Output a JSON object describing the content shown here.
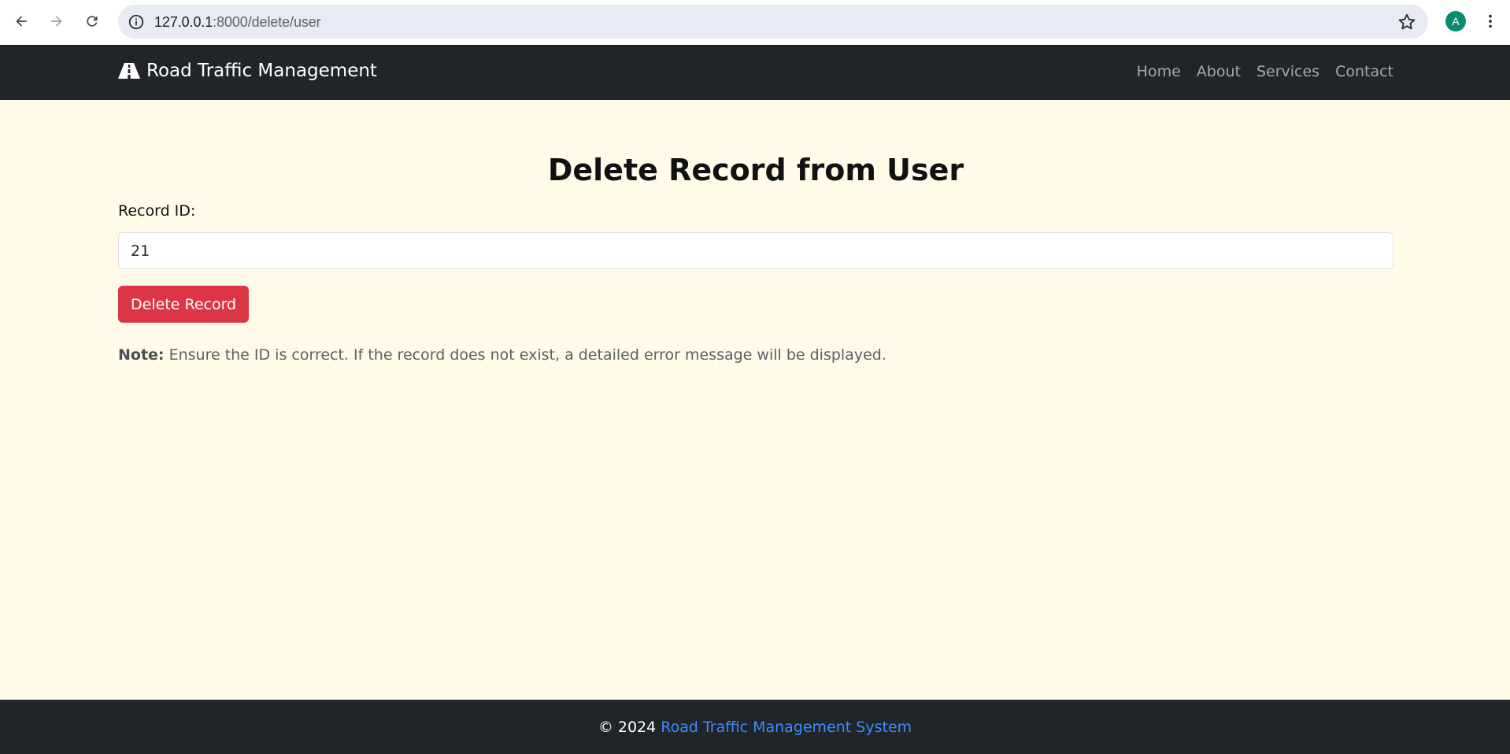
{
  "browser": {
    "url_host": "127.0.0.1",
    "url_rest": ":8000/delete/user",
    "profile_initial": "A",
    "icons": [
      "back-arrow-icon",
      "forward-arrow-icon",
      "reload-icon",
      "site-info-icon",
      "star-icon",
      "more-vert-icon"
    ]
  },
  "navbar": {
    "brand_icon": "road-icon",
    "brand_text": "Road Traffic Management",
    "links": [
      "Home",
      "About",
      "Services",
      "Contact"
    ]
  },
  "main": {
    "title": "Delete Record from User",
    "field_label": "Record ID:",
    "field_value": "21",
    "button_label": "Delete Record",
    "note_label": "Note:",
    "note_text": "Ensure the ID is correct. If the record does not exist, a detailed error message will be displayed."
  },
  "footer": {
    "copyright": "© 2024",
    "link_text": "Road Traffic Management System"
  },
  "colors": {
    "page_bg": "#fffbe8",
    "navbar_bg": "#212529",
    "danger": "#dc3545",
    "link": "#3d8bfd"
  }
}
